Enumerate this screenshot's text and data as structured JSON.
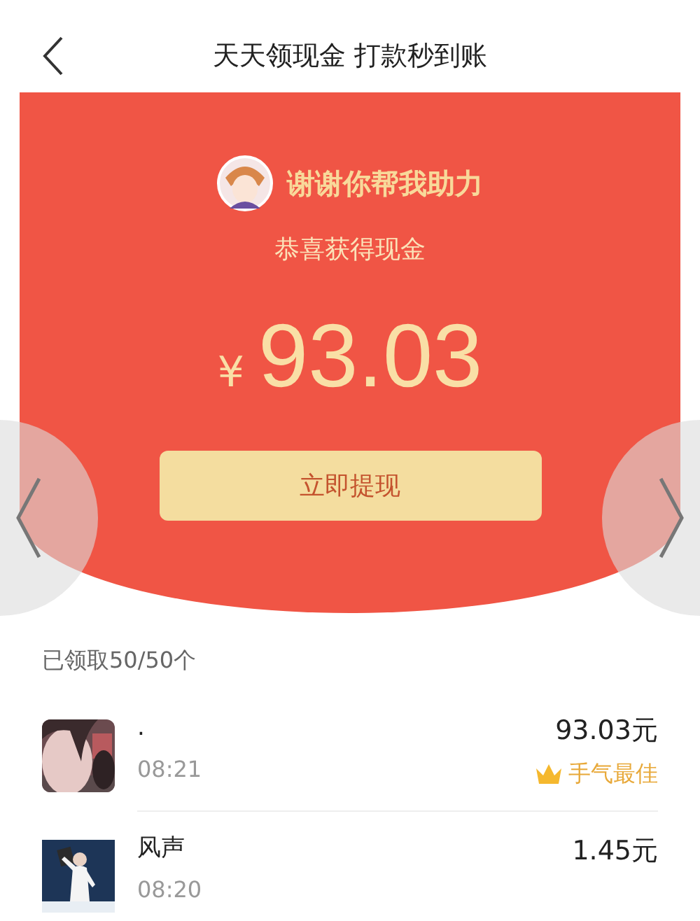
{
  "header": {
    "title": "天天领现金 打款秒到账"
  },
  "card": {
    "message": "谢谢你帮我助力",
    "subtitle": "恭喜获得现金",
    "currency": "¥",
    "amount": "93.03",
    "button": "立即提现"
  },
  "summary": "已领取50/50个",
  "records": [
    {
      "name": ".",
      "time": "08:21",
      "amount": "93.03元",
      "badge": "手气最佳"
    },
    {
      "name": "风声",
      "time": "08:20",
      "amount": "1.45元"
    }
  ]
}
